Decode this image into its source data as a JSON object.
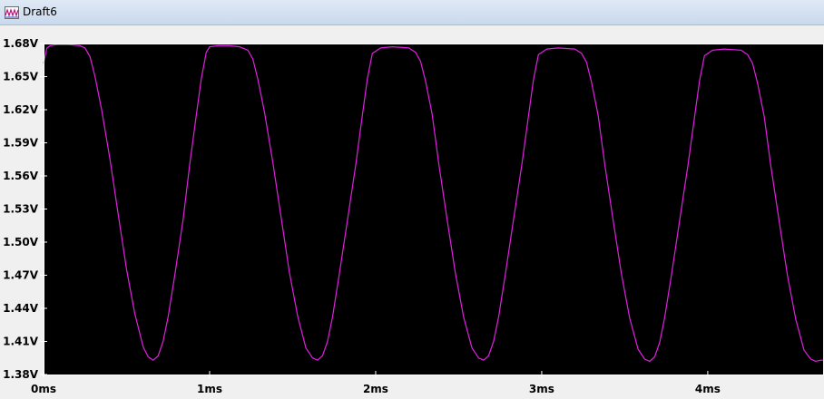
{
  "window": {
    "title": "Draft6",
    "icon": "waveform-viewer-icon"
  },
  "colors": {
    "plot_background": "#000000",
    "trace": "#e020e0",
    "frame": "#ffffff",
    "panel": "#f0f0f0"
  },
  "chart_data": {
    "type": "line",
    "title": "",
    "xlabel": "",
    "ylabel": "",
    "grid": false,
    "xlim": [
      0,
      4.7
    ],
    "ylim": [
      1.38,
      1.68
    ],
    "x_unit": "ms",
    "y_unit": "V",
    "xticks": [
      "0ms",
      "1ms",
      "2ms",
      "3ms",
      "4ms"
    ],
    "xtick_values": [
      0,
      1,
      2,
      3,
      4
    ],
    "yticks": [
      "1.68V",
      "1.65V",
      "1.62V",
      "1.59V",
      "1.56V",
      "1.53V",
      "1.50V",
      "1.47V",
      "1.44V",
      "1.41V",
      "1.38V"
    ],
    "ytick_values": [
      1.68,
      1.65,
      1.62,
      1.59,
      1.56,
      1.53,
      1.5,
      1.47,
      1.44,
      1.41,
      1.38
    ],
    "series": [
      {
        "x": [
          0.0,
          0.02,
          0.04,
          0.08,
          0.15,
          0.22,
          0.25,
          0.28,
          0.31,
          0.35,
          0.4,
          0.45,
          0.5,
          0.55,
          0.6,
          0.63,
          0.66,
          0.69,
          0.72,
          0.75,
          0.79,
          0.84,
          0.88,
          0.92,
          0.95,
          0.98,
          1.0,
          1.05,
          1.12,
          1.18,
          1.23,
          1.26,
          1.29,
          1.33,
          1.38,
          1.43,
          1.48,
          1.53,
          1.58,
          1.62,
          1.65,
          1.68,
          1.71,
          1.74,
          1.78,
          1.83,
          1.88,
          1.92,
          1.95,
          1.98,
          2.03,
          2.1,
          2.2,
          2.24,
          2.27,
          2.3,
          2.34,
          2.38,
          2.43,
          2.48,
          2.53,
          2.58,
          2.62,
          2.65,
          2.68,
          2.71,
          2.74,
          2.78,
          2.83,
          2.88,
          2.92,
          2.95,
          2.98,
          3.03,
          3.1,
          3.2,
          3.24,
          3.27,
          3.3,
          3.34,
          3.38,
          3.43,
          3.48,
          3.53,
          3.58,
          3.62,
          3.65,
          3.68,
          3.71,
          3.74,
          3.78,
          3.83,
          3.88,
          3.92,
          3.95,
          3.98,
          4.03,
          4.1,
          4.2,
          4.24,
          4.27,
          4.3,
          4.34,
          4.38,
          4.43,
          4.48,
          4.53,
          4.58,
          4.62,
          4.65,
          4.68,
          4.7
        ],
        "y": [
          1.662,
          1.676,
          1.678,
          1.679,
          1.679,
          1.678,
          1.676,
          1.668,
          1.65,
          1.62,
          1.575,
          1.525,
          1.475,
          1.435,
          1.405,
          1.396,
          1.393,
          1.397,
          1.41,
          1.432,
          1.47,
          1.52,
          1.57,
          1.615,
          1.648,
          1.672,
          1.677,
          1.678,
          1.678,
          1.677,
          1.674,
          1.666,
          1.648,
          1.618,
          1.573,
          1.523,
          1.473,
          1.433,
          1.404,
          1.395,
          1.393,
          1.397,
          1.41,
          1.432,
          1.47,
          1.52,
          1.57,
          1.615,
          1.648,
          1.671,
          1.676,
          1.677,
          1.676,
          1.672,
          1.664,
          1.646,
          1.616,
          1.571,
          1.521,
          1.472,
          1.432,
          1.404,
          1.395,
          1.393,
          1.397,
          1.41,
          1.432,
          1.47,
          1.52,
          1.57,
          1.614,
          1.647,
          1.67,
          1.675,
          1.676,
          1.675,
          1.671,
          1.663,
          1.645,
          1.615,
          1.57,
          1.52,
          1.471,
          1.431,
          1.403,
          1.394,
          1.392,
          1.396,
          1.409,
          1.431,
          1.469,
          1.519,
          1.569,
          1.613,
          1.646,
          1.669,
          1.674,
          1.675,
          1.674,
          1.67,
          1.662,
          1.644,
          1.614,
          1.569,
          1.519,
          1.47,
          1.43,
          1.402,
          1.394,
          1.392,
          1.393,
          1.393
        ]
      }
    ]
  }
}
